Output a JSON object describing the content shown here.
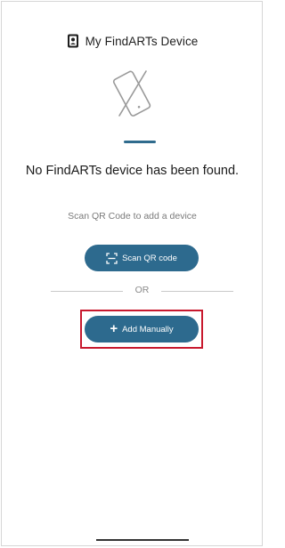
{
  "header": {
    "title": "My FindARTs Device",
    "icon": "phone-device-icon"
  },
  "hero": {
    "icon": "device-not-found-icon",
    "accent_color": "#2f6b8d"
  },
  "main": {
    "empty_message": "No FindARTs device has been found.",
    "scan_hint": "Scan QR Code to add a device",
    "scan_button": {
      "label": "Scan QR code",
      "icon": "qr-scan-icon"
    },
    "divider_text": "OR",
    "add_button": {
      "label": "Add Manually",
      "icon": "plus-icon"
    }
  },
  "colors": {
    "button_bg": "#2d6a8e",
    "highlight_border": "#c8192e"
  }
}
